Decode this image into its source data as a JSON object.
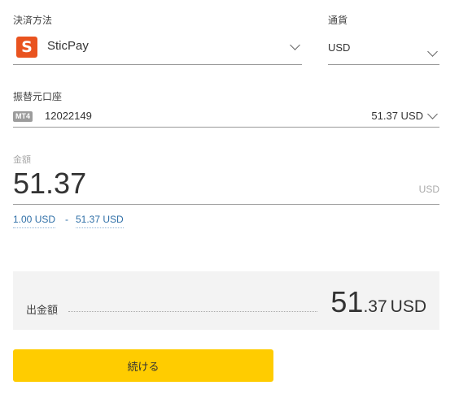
{
  "form": {
    "payment_method": {
      "label": "決済方法",
      "logo_letter": "S",
      "logo_color": "#e9531f",
      "value": "SticPay",
      "icon": "chevron-down-icon"
    },
    "currency": {
      "label": "通貨",
      "value": "USD",
      "icon": "chevron-down-icon"
    },
    "source_account": {
      "label": "振替元口座",
      "platform_badge": "MT4",
      "account_number": "12022149",
      "balance": "51.37 USD",
      "icon": "chevron-down-icon"
    },
    "amount": {
      "label": "金額",
      "value": "51.37",
      "unit": "USD",
      "min": "1.00 USD",
      "separator": "-",
      "max": "51.37 USD"
    }
  },
  "summary": {
    "label": "出金額",
    "amount_integer": "51",
    "amount_decimal": ".37",
    "currency": "USD"
  },
  "actions": {
    "continue_label": "続ける",
    "continue_color": "#ffcc00"
  }
}
